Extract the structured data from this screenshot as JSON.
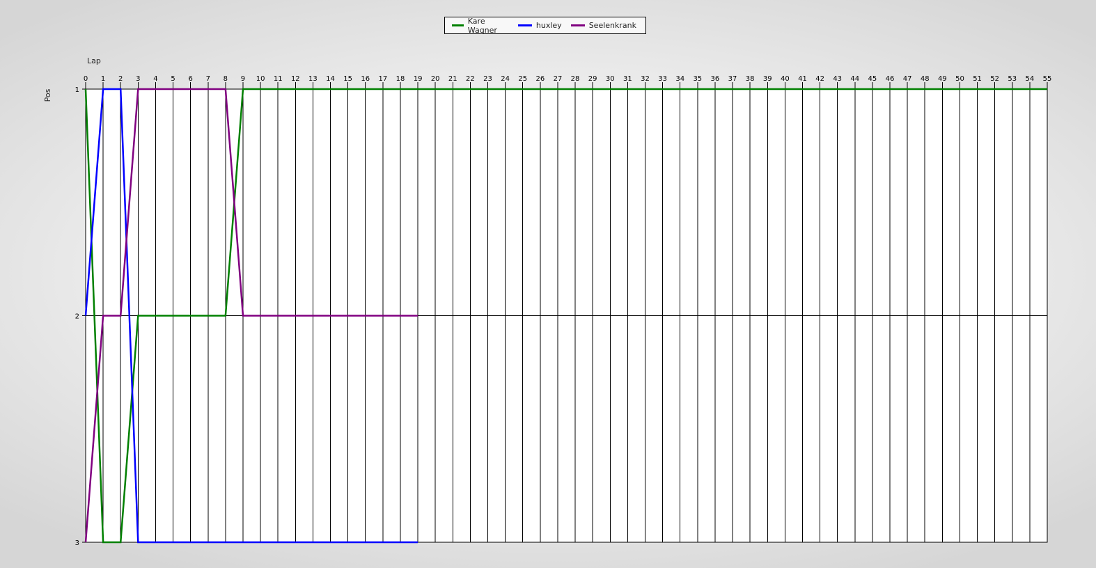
{
  "chart_data": {
    "type": "line",
    "title": "",
    "xlabel": "Lap",
    "ylabel": "Pos",
    "xlim": [
      0,
      55
    ],
    "ylim": [
      1,
      3
    ],
    "y_inverted": true,
    "grid": true,
    "legend_position": "top-center",
    "x_ticks": [
      0,
      1,
      2,
      3,
      4,
      5,
      6,
      7,
      8,
      9,
      10,
      11,
      12,
      13,
      14,
      15,
      16,
      17,
      18,
      19,
      20,
      21,
      22,
      23,
      24,
      25,
      26,
      27,
      28,
      29,
      30,
      31,
      32,
      33,
      34,
      35,
      36,
      37,
      38,
      39,
      40,
      41,
      42,
      43,
      44,
      45,
      46,
      47,
      48,
      49,
      50,
      51,
      52,
      53,
      54,
      55
    ],
    "y_ticks": [
      1,
      2,
      3
    ],
    "series": [
      {
        "name": "Kare Wagner",
        "color": "#008000",
        "x": [
          0,
          1,
          2,
          3,
          4,
          5,
          6,
          7,
          8,
          9,
          10,
          11,
          12,
          13,
          14,
          15,
          16,
          17,
          18,
          19,
          20,
          21,
          22,
          23,
          24,
          25,
          26,
          27,
          28,
          29,
          30,
          31,
          32,
          33,
          34,
          35,
          36,
          37,
          38,
          39,
          40,
          41,
          42,
          43,
          44,
          45,
          46,
          47,
          48,
          49,
          50,
          51,
          52,
          53,
          54,
          55
        ],
        "y": [
          1,
          3,
          3,
          2,
          2,
          2,
          2,
          2,
          2,
          1,
          1,
          1,
          1,
          1,
          1,
          1,
          1,
          1,
          1,
          1,
          1,
          1,
          1,
          1,
          1,
          1,
          1,
          1,
          1,
          1,
          1,
          1,
          1,
          1,
          1,
          1,
          1,
          1,
          1,
          1,
          1,
          1,
          1,
          1,
          1,
          1,
          1,
          1,
          1,
          1,
          1,
          1,
          1,
          1,
          1,
          1
        ]
      },
      {
        "name": "huxley",
        "color": "#0000ff",
        "x": [
          0,
          1,
          2,
          3,
          4,
          5,
          6,
          7,
          8,
          9,
          10,
          11,
          12,
          13,
          14,
          15,
          16,
          17,
          18,
          19
        ],
        "y": [
          2,
          1,
          1,
          3,
          3,
          3,
          3,
          3,
          3,
          3,
          3,
          3,
          3,
          3,
          3,
          3,
          3,
          3,
          3,
          3
        ]
      },
      {
        "name": "Seelenkrank",
        "color": "#800080",
        "x": [
          0,
          1,
          2,
          3,
          4,
          5,
          6,
          7,
          8,
          9,
          10,
          11,
          12,
          13,
          14,
          15,
          16,
          17,
          18,
          19
        ],
        "y": [
          3,
          2,
          2,
          1,
          1,
          1,
          1,
          1,
          1,
          2,
          2,
          2,
          2,
          2,
          2,
          2,
          2,
          2,
          2,
          2
        ]
      }
    ]
  }
}
